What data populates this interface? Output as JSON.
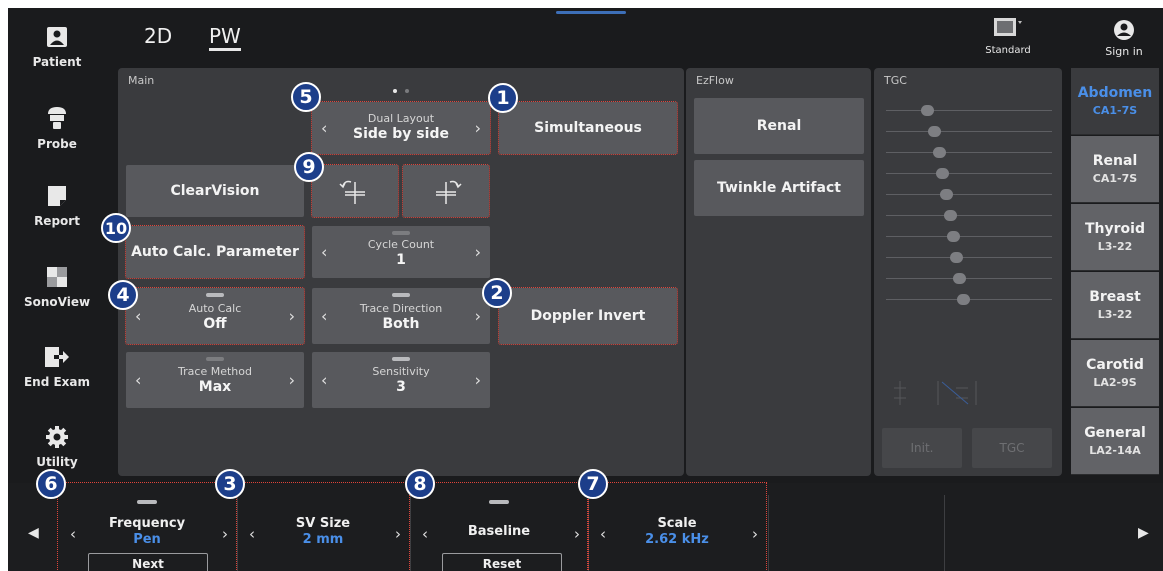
{
  "top_bar": {
    "tabs": [
      "2D",
      "PW"
    ],
    "active_tab": "PW",
    "display_mode_label": "Standard",
    "sign_in_label": "Sign in"
  },
  "sidebar": {
    "items": [
      {
        "label": "Patient",
        "icon": "patient-icon"
      },
      {
        "label": "Probe",
        "icon": "probe-icon"
      },
      {
        "label": "Report",
        "icon": "report-icon"
      },
      {
        "label": "SonoView",
        "icon": "sonoview-icon"
      },
      {
        "label": "End Exam",
        "icon": "end-exam-icon"
      },
      {
        "label": "Utility",
        "icon": "utility-icon"
      }
    ]
  },
  "main_panel": {
    "title": "Main",
    "dual_layout": {
      "label": "Dual Layout",
      "value": "Side by side"
    },
    "simultaneous_label": "Simultaneous",
    "clearvision_label": "ClearVision",
    "auto_calc_parameter_label": "Auto Calc. Parameter",
    "cycle_count": {
      "label": "Cycle Count",
      "value": "1"
    },
    "auto_calc": {
      "label": "Auto Calc",
      "value": "Off"
    },
    "trace_direction": {
      "label": "Trace Direction",
      "value": "Both"
    },
    "doppler_invert_label": "Doppler Invert",
    "trace_method": {
      "label": "Trace Method",
      "value": "Max"
    },
    "sensitivity": {
      "label": "Sensitivity",
      "value": "3"
    }
  },
  "ezflow_panel": {
    "title": "EzFlow",
    "buttons": [
      "Renal",
      "Twinkle Artifact"
    ]
  },
  "tgc_panel": {
    "title": "TGC",
    "slider_levels": [
      0.55,
      0.62,
      0.67,
      0.7,
      0.74,
      0.78,
      0.81,
      0.84,
      0.87,
      0.91
    ],
    "init_label": "Init.",
    "tgc_label": "TGC"
  },
  "presets": [
    {
      "name": "Abdomen",
      "probe": "CA1-7S",
      "active": true
    },
    {
      "name": "Renal",
      "probe": "CA1-7S",
      "active": false
    },
    {
      "name": "Thyroid",
      "probe": "L3-22",
      "active": false
    },
    {
      "name": "Breast",
      "probe": "L3-22",
      "active": false
    },
    {
      "name": "Carotid",
      "probe": "LA2-9S",
      "active": false
    },
    {
      "name": "General",
      "probe": "LA2-14A",
      "active": false
    }
  ],
  "bottom_controls": {
    "frequency": {
      "label": "Frequency",
      "value": "Pen",
      "button": "Next"
    },
    "sv_size": {
      "label": "SV Size",
      "value": "2 mm"
    },
    "baseline": {
      "label": "Baseline",
      "button": "Reset"
    },
    "scale": {
      "label": "Scale",
      "value": "2.62 kHz"
    }
  },
  "badges": [
    "1",
    "2",
    "3",
    "4",
    "5",
    "6",
    "7",
    "8",
    "9",
    "10"
  ],
  "colors": {
    "accent_blue": "#4a8fe8",
    "badge_blue": "#1c3e8a",
    "highlight_red": "#e0443a",
    "panel": "#3a3b3e",
    "button": "#58595d"
  }
}
